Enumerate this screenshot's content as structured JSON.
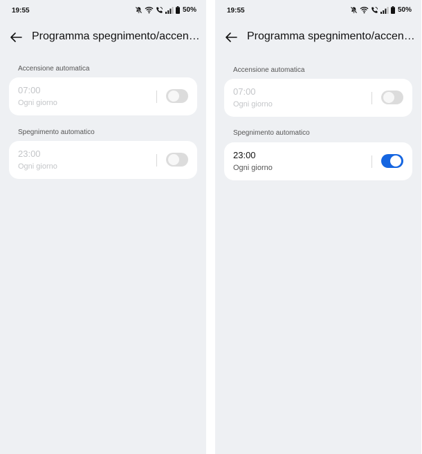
{
  "screens": [
    {
      "status": {
        "time": "19:55",
        "battery": "50%"
      },
      "title": "Programma spegnimento/accensione",
      "power_on": {
        "section_label": "Accensione automatica",
        "time": "07:00",
        "repeat": "Ogni giorno",
        "enabled": false
      },
      "power_off": {
        "section_label": "Spegnimento automatico",
        "time": "23:00",
        "repeat": "Ogni giorno",
        "enabled": false
      }
    },
    {
      "status": {
        "time": "19:55",
        "battery": "50%"
      },
      "title": "Programma spegnimento/accensione",
      "power_on": {
        "section_label": "Accensione automatica",
        "time": "07:00",
        "repeat": "Ogni giorno",
        "enabled": false
      },
      "power_off": {
        "section_label": "Spegnimento automatico",
        "time": "23:00",
        "repeat": "Ogni giorno",
        "enabled": true
      }
    }
  ],
  "colors": {
    "accent": "#1565e0",
    "background": "#eef0f3",
    "card": "#ffffff",
    "toggle_off": "#dcdcdc",
    "disabled_text": "#c3c5c8"
  },
  "icons": {
    "back": "arrow-left-icon",
    "mute": "bell-off-icon",
    "wifi": "wifi-icon",
    "call": "wifi-call-icon",
    "signal": "signal-icon",
    "battery": "battery-icon"
  }
}
